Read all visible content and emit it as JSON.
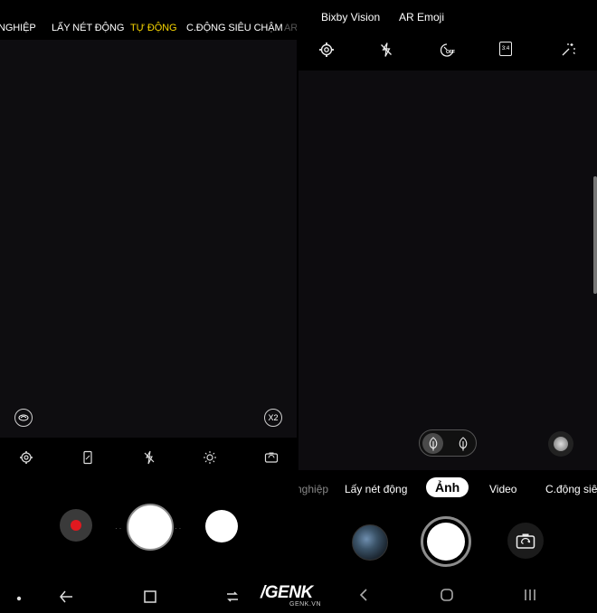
{
  "left": {
    "modes": [
      {
        "label": "NGHIỆP",
        "state": "normal"
      },
      {
        "label": "LẤY NÉT ĐỘNG",
        "state": "normal"
      },
      {
        "label": "TỰ ĐỘNG",
        "state": "active"
      },
      {
        "label": "C.ĐỘNG SIÊU CHẬM",
        "state": "normal"
      },
      {
        "label": "AR",
        "state": "faded"
      }
    ],
    "zoom_label": "X2",
    "icons": [
      "settings-icon",
      "aspect-ratio-icon",
      "flash-off-icon",
      "brightness-icon",
      "switch-camera-icon"
    ],
    "accent_color": "#f5d400",
    "record_color": "#e0191f"
  },
  "right": {
    "top_tabs": [
      "Bixby Vision",
      "AR Emoji"
    ],
    "icons": [
      "settings-icon",
      "flash-off-icon",
      "timer-off-icon",
      "ratio-3-4-icon",
      "effects-icon"
    ],
    "ratio_label": "3:4",
    "timer_label": "OFF",
    "modes": [
      {
        "label": "nghiệp",
        "state": "faded"
      },
      {
        "label": "Lấy nét động",
        "state": "normal"
      },
      {
        "label": "Ảnh",
        "state": "active"
      },
      {
        "label": "Video",
        "state": "normal"
      },
      {
        "label": "C.động siêu",
        "state": "normal"
      }
    ]
  },
  "watermark": {
    "brand": "/GENK",
    "domain": "GENK.VN"
  }
}
